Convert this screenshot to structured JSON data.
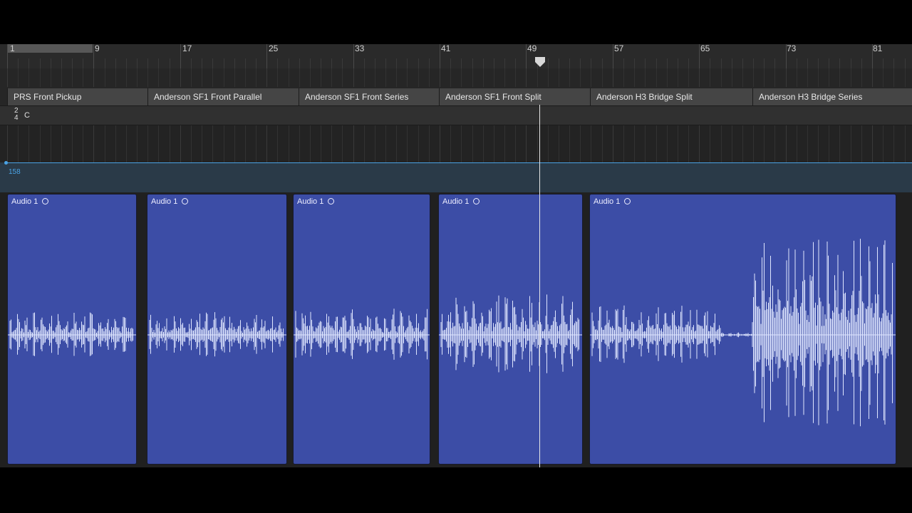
{
  "ruler": {
    "bar_numbers": [
      "1",
      "9",
      "17",
      "25",
      "33",
      "41",
      "49",
      "57",
      "65",
      "73",
      "81"
    ]
  },
  "markers": [
    {
      "label": "PRS Front Pickup"
    },
    {
      "label": "Anderson SF1 Front Parallel"
    },
    {
      "label": "Anderson SF1 Front Series"
    },
    {
      "label": "Anderson SF1 Front Split"
    },
    {
      "label": "Anderson H3 Bridge Split"
    },
    {
      "label": "Anderson H3 Bridge Series"
    }
  ],
  "signature": {
    "numerator": "2",
    "denominator": "4",
    "key": "C"
  },
  "tempo": {
    "value": "158"
  },
  "regions": [
    {
      "name": "Audio 1",
      "icon": "loop-circle-icon",
      "level": 0.17
    },
    {
      "name": "Audio 1",
      "icon": "loop-circle-icon",
      "level": 0.17
    },
    {
      "name": "Audio 1",
      "icon": "loop-circle-icon",
      "level": 0.2
    },
    {
      "name": "Audio 1",
      "icon": "loop-circle-icon",
      "level": 0.3
    },
    {
      "name": "Audio 1",
      "icon": "loop-circle-icon",
      "level": 0.45
    }
  ],
  "colors": {
    "region": "#3c4da6",
    "waveform": "#dfe6ff",
    "tempo_line": "#4aa3e6"
  }
}
